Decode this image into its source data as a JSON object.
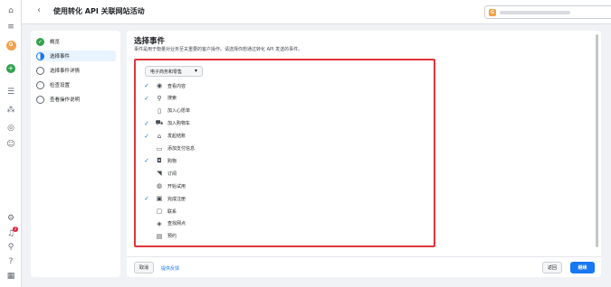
{
  "header": {
    "title": "使用转化 API 关联网站活动",
    "account_initial": "G"
  },
  "rail": {
    "avatar_initial": "G",
    "notification_count": "2"
  },
  "steps": [
    {
      "label": "概览",
      "state": "done"
    },
    {
      "label": "选择事件",
      "state": "active"
    },
    {
      "label": "选择事件详情",
      "state": "todo"
    },
    {
      "label": "检查设置",
      "state": "todo"
    },
    {
      "label": "查看操作说明",
      "state": "todo"
    }
  ],
  "main": {
    "title": "选择事件",
    "description": "事件是用于衡量对业务至关重要的客户操作。请选择你想通过转化 API 发送的事件。",
    "category_dropdown": "电子商务和零售",
    "events": [
      {
        "label": "查看内容",
        "checked": true,
        "icon": "eye-icon"
      },
      {
        "label": "搜索",
        "checked": true,
        "icon": "search-icon"
      },
      {
        "label": "加入心愿单",
        "checked": false,
        "icon": "clipboard-icon"
      },
      {
        "label": "加入购物车",
        "checked": true,
        "icon": "cart-icon"
      },
      {
        "label": "发起结账",
        "checked": true,
        "icon": "bank-icon"
      },
      {
        "label": "添加支付信息",
        "checked": false,
        "icon": "credit-card-icon"
      },
      {
        "label": "购物",
        "checked": true,
        "icon": "bag-icon"
      },
      {
        "label": "订阅",
        "checked": false,
        "icon": "rss-icon"
      },
      {
        "label": "开始试用",
        "checked": false,
        "icon": "trial-icon"
      },
      {
        "label": "完成注册",
        "checked": true,
        "icon": "form-check-icon"
      },
      {
        "label": "联系",
        "checked": false,
        "icon": "chat-icon"
      },
      {
        "label": "查找网点",
        "checked": false,
        "icon": "location-icon"
      },
      {
        "label": "预约",
        "checked": false,
        "icon": "calendar-icon"
      }
    ]
  },
  "footer": {
    "cancel_label": "取消",
    "feedback_label": "提供反馈",
    "back_label": "返回",
    "next_label": "继续"
  },
  "colors": {
    "accent": "#1877f2",
    "highlight_border": "#e0353a",
    "done_green": "#31a24c"
  }
}
